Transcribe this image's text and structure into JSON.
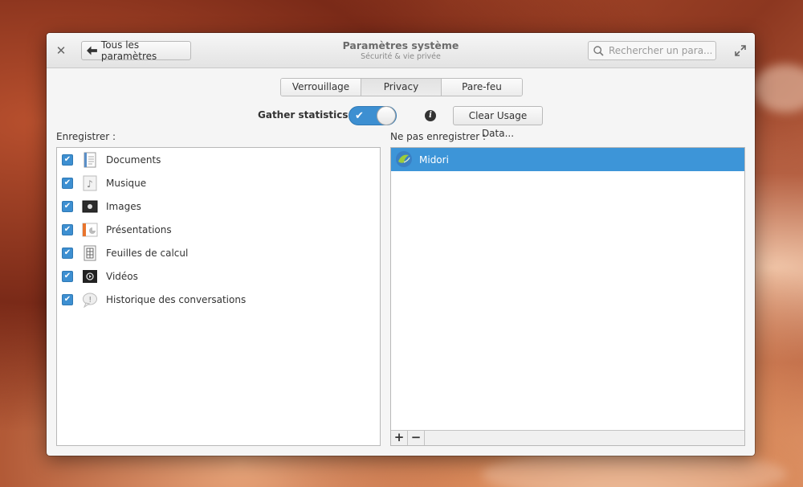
{
  "window": {
    "title": "Paramètres système",
    "subtitle": "Sécurité & vie privée"
  },
  "header": {
    "close_icon": "close-icon",
    "back_label": "Tous les paramètres",
    "search_placeholder": "Rechercher un para...",
    "maximize_icon": "maximize-icon"
  },
  "tabs": [
    {
      "label": "Verrouillage",
      "active": false
    },
    {
      "label": "Privacy",
      "active": true
    },
    {
      "label": "Pare-feu",
      "active": false
    }
  ],
  "statistics": {
    "label": "Gather statistics:",
    "enabled": true,
    "clear_label": "Clear Usage Data..."
  },
  "record": {
    "heading": "Enregistrer :",
    "items": [
      {
        "label": "Documents",
        "checked": true,
        "icon": "document-icon"
      },
      {
        "label": "Musique",
        "checked": true,
        "icon": "music-icon"
      },
      {
        "label": "Images",
        "checked": true,
        "icon": "image-icon"
      },
      {
        "label": "Présentations",
        "checked": true,
        "icon": "presentation-icon"
      },
      {
        "label": "Feuilles de calcul",
        "checked": true,
        "icon": "spreadsheet-icon"
      },
      {
        "label": "Vidéos",
        "checked": true,
        "icon": "video-icon"
      },
      {
        "label": "Historique des conversations",
        "checked": true,
        "icon": "chat-icon"
      }
    ]
  },
  "do_not_record": {
    "heading": "Ne pas enregistrer :",
    "items": [
      {
        "label": "Midori",
        "selected": true,
        "icon": "midori-icon"
      }
    ],
    "add_label": "+",
    "remove_label": "−"
  },
  "colors": {
    "accent": "#3d95d8"
  }
}
